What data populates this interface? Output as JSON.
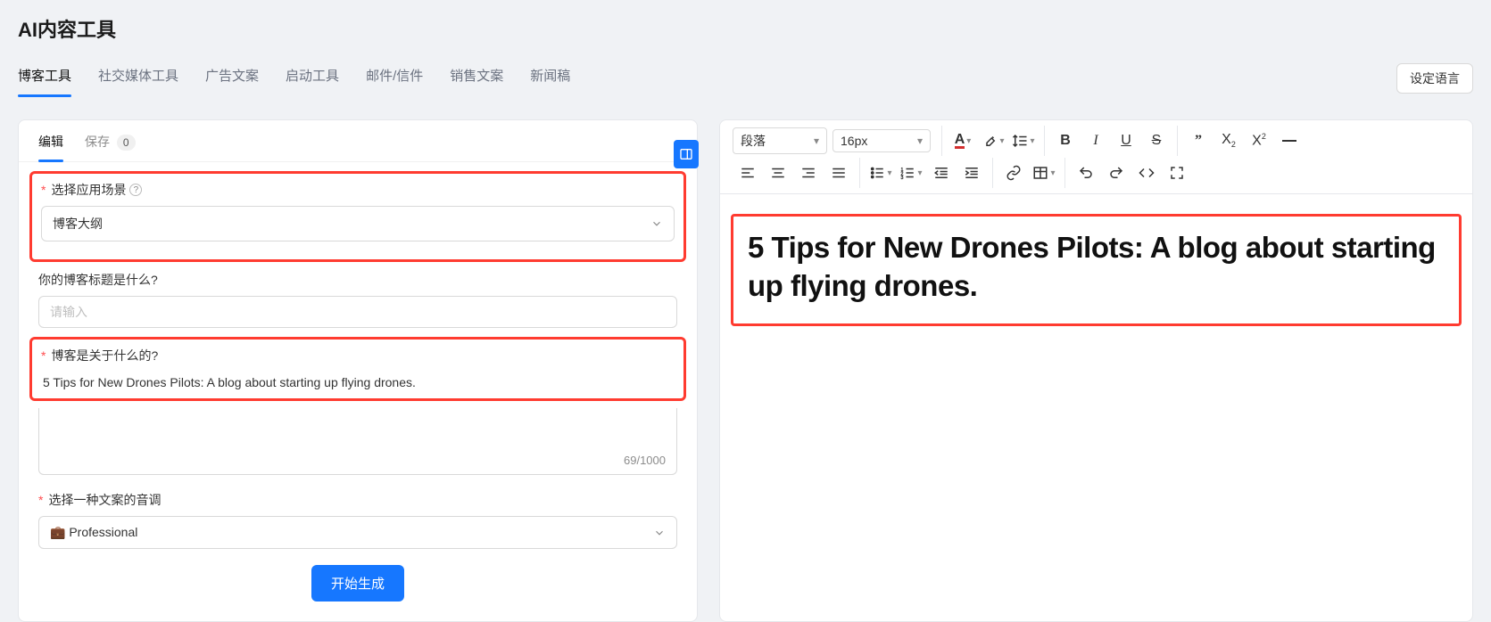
{
  "header": {
    "title": "AI内容工具"
  },
  "top_tabs": {
    "active_index": 0,
    "items": [
      "博客工具",
      "社交媒体工具",
      "广告文案",
      "启动工具",
      "邮件/信件",
      "销售文案",
      "新闻稿"
    ],
    "lang_button": "设定语言"
  },
  "left": {
    "tabs": {
      "active_index": 0,
      "items": [
        {
          "label": "编辑"
        },
        {
          "label": "保存",
          "badge": "0"
        }
      ]
    },
    "form": {
      "scene_label": "选择应用场景",
      "scene_value": "博客大纲",
      "title_label": "你的博客标题是什么?",
      "title_placeholder": "请输入",
      "title_value": "",
      "about_label": "博客是关于什么的?",
      "about_value": "5 Tips for New Drones Pilots: A blog about starting up flying drones.",
      "about_counter": "69/1000",
      "tone_label": "选择一种文案的音调",
      "tone_emoji": "💼",
      "tone_value": "Professional",
      "generate_button": "开始生成"
    }
  },
  "editor": {
    "toolbar": {
      "format_select": "段落",
      "size_select": "16px"
    },
    "heading": "5 Tips for New Drones Pilots: A blog about starting up flying drones."
  }
}
